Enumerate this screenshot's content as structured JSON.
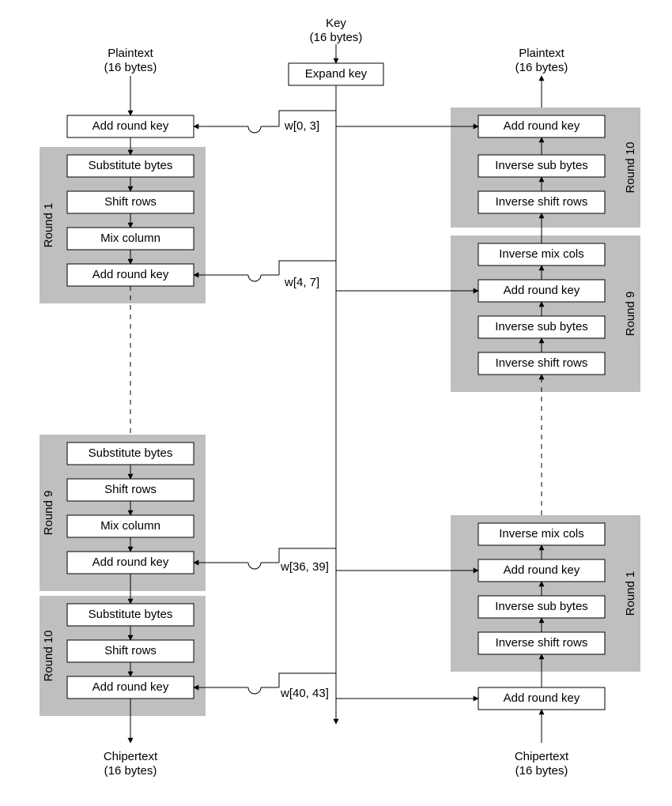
{
  "header": {
    "key_title": "Key",
    "key_subtitle": "(16 bytes)",
    "expand_key": "Expand key"
  },
  "left": {
    "plaintext_title": "Plaintext",
    "plaintext_subtitle": "(16 bytes)",
    "initial_add": "Add round key",
    "round1": {
      "label": "Round 1",
      "sub": "Substitute bytes",
      "shift": "Shift rows",
      "mix": "Mix column",
      "add": "Add round key"
    },
    "round9": {
      "label": "Round 9",
      "sub": "Substitute bytes",
      "shift": "Shift rows",
      "mix": "Mix column",
      "add": "Add round key"
    },
    "round10": {
      "label": "Round 10",
      "sub": "Substitute bytes",
      "shift": "Shift rows",
      "add": "Add round key"
    },
    "ciphertext_title": "Chipertext",
    "ciphertext_subtitle": "(16 bytes)"
  },
  "right": {
    "plaintext_title": "Plaintext",
    "plaintext_subtitle": "(16 bytes)",
    "round10": {
      "label": "Round 10",
      "add": "Add round key",
      "sub": "Inverse sub bytes",
      "shift": "Inverse shift rows"
    },
    "round9": {
      "label": "Round 9",
      "mix": "Inverse mix cols",
      "add": "Add round key",
      "sub": "Inverse sub bytes",
      "shift": "Inverse shift rows"
    },
    "round1": {
      "label": "Round 1",
      "mix": "Inverse mix cols",
      "add": "Add round key",
      "sub": "Inverse sub bytes",
      "shift": "Inverse shift rows"
    },
    "final_add": "Add round key",
    "ciphertext_title": "Chipertext",
    "ciphertext_subtitle": "(16 bytes)"
  },
  "keys": {
    "w0": "w[0, 3]",
    "w1": "w[4, 7]",
    "w2": "w[36, 39]",
    "w3": "w[40, 43]"
  }
}
